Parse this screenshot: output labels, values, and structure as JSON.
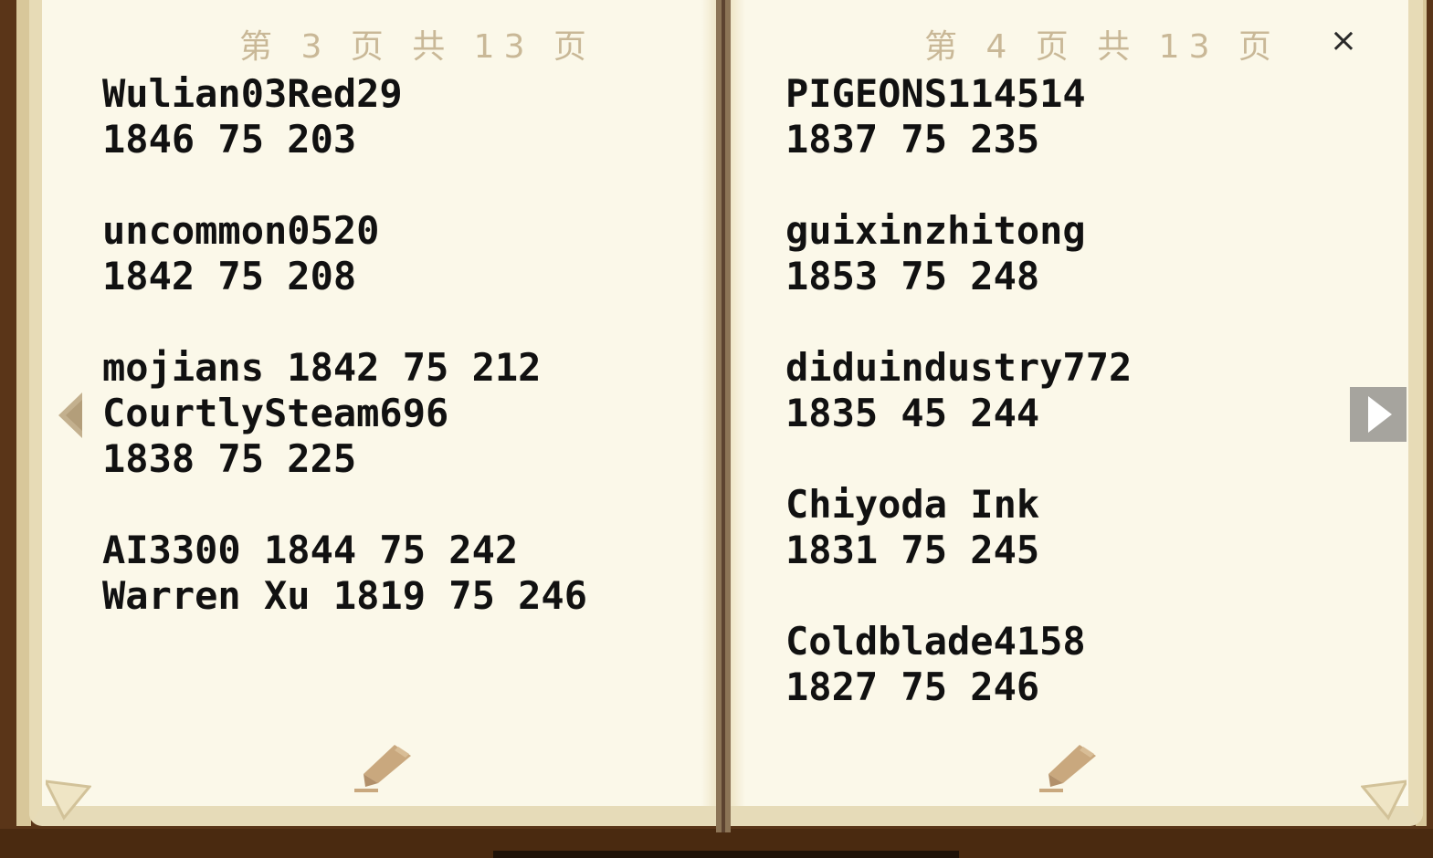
{
  "left_page": {
    "page_indicator": "第 3 页 共 13 页",
    "lines": [
      "Wulian03Red29",
      "1846 75 203",
      "",
      "uncommon0520",
      "1842 75 208",
      "",
      "mojians 1842 75 212",
      "CourtlySteam696",
      "1838 75 225",
      "",
      "AI3300 1844 75 242",
      "Warren Xu 1819 75 246"
    ]
  },
  "right_page": {
    "page_indicator": "第 4 页 共 13 页",
    "lines": [
      "PIGEONS114514",
      "1837 75 235",
      "",
      "guixinzhitong",
      "1853 75 248",
      "",
      "diduindustry772",
      "1835 45 244",
      "",
      "Chiyoda Ink",
      "1831 75 245",
      "",
      "Coldblade4158",
      "1827 75 246"
    ]
  },
  "controls": {
    "close_label": "×",
    "prev_icon": "triangle-left-icon",
    "next_icon": "triangle-right-icon",
    "edit_icon": "pencil-icon"
  },
  "colors": {
    "page": "#fbf8e9",
    "page_edge": "#e7dbb6",
    "cover": "#5a3518",
    "text": "#111111",
    "page_indicator": "#c9b897",
    "next_button": "#a6a49e"
  }
}
